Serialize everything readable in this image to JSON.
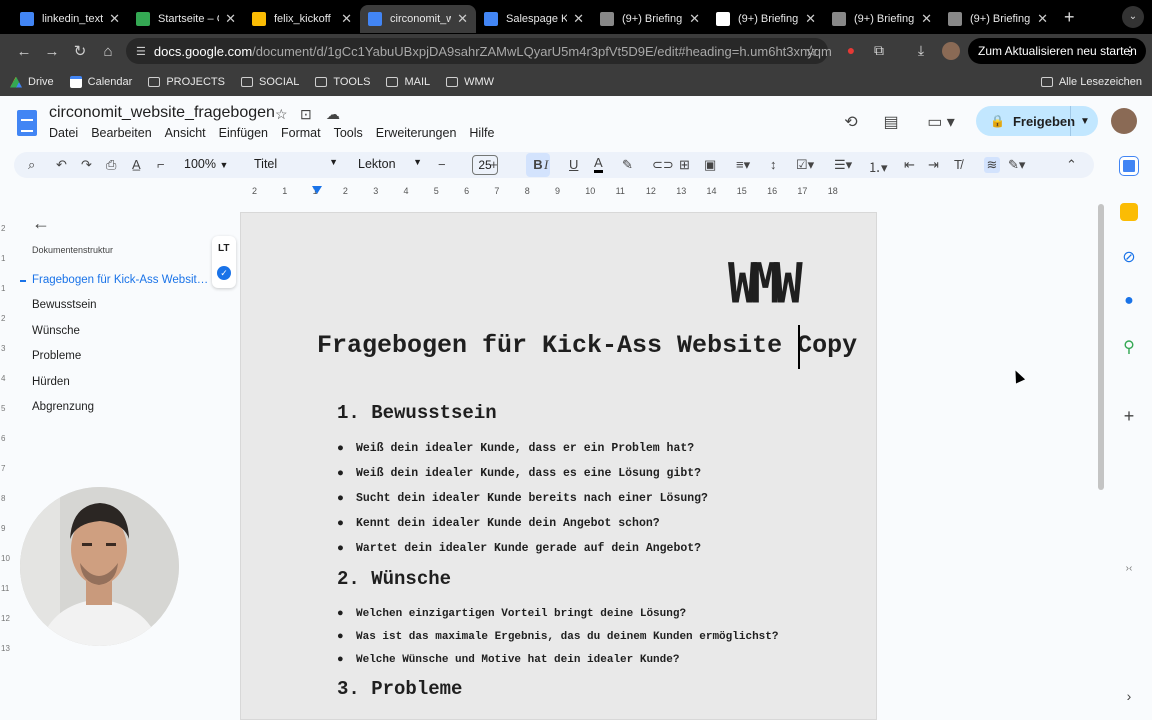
{
  "browser": {
    "tabs": [
      {
        "title": "linkedin_text",
        "color": "#4285f4"
      },
      {
        "title": "Startseite – G",
        "color": "#34a853"
      },
      {
        "title": "felix_kickoff",
        "color": "#fbbc04"
      },
      {
        "title": "circonomit_w",
        "color": "#4285f4"
      },
      {
        "title": "Salespage K",
        "color": "#4285f4"
      },
      {
        "title": "(9+) Briefing",
        "color": "#888888"
      },
      {
        "title": "(9+) Briefing",
        "color": "#ffffff"
      },
      {
        "title": "(9+) Briefing",
        "color": "#888888"
      },
      {
        "title": "(9+) Briefing",
        "color": "#888888"
      }
    ],
    "active_tab_index": 3,
    "url_host": "docs.google.com",
    "url_path": "/document/d/1gCc1YabuUBxpjDA9sahrZAMwLQyarU5m4r3pfVt5D9E/edit#heading=h.um6ht3xnyqm",
    "update_label": "Zum Aktualisieren neu starten",
    "bookmarks": [
      "Drive",
      "Calendar",
      "PROJECTS",
      "SOCIAL",
      "TOOLS",
      "MAIL",
      "WMW"
    ],
    "all_bookmarks": "Alle Lesezeichen"
  },
  "doc": {
    "title": "circonomit_website_fragebogen",
    "menu": [
      "Datei",
      "Bearbeiten",
      "Ansicht",
      "Einfügen",
      "Format",
      "Tools",
      "Erweiterungen",
      "Hilfe"
    ],
    "share_label": "Freigeben"
  },
  "toolbar": {
    "zoom": "100%",
    "style": "Titel",
    "font": "Lekton",
    "font_size": "25"
  },
  "ruler": [
    "2",
    "1",
    "1",
    "2",
    "3",
    "4",
    "5",
    "6",
    "7",
    "8",
    "9",
    "10",
    "11",
    "12",
    "13",
    "14",
    "15",
    "16",
    "17",
    "18"
  ],
  "outline": {
    "header": "Dokumentenstruktur",
    "items": [
      "Fragebogen für Kick-Ass Websit…",
      "Bewusstsein",
      "Wünsche",
      "Probleme",
      "Hürden",
      "Abgrenzung"
    ]
  },
  "content": {
    "logo": "WMW",
    "title": "Fragebogen für Kick-Ass Website Copy",
    "sections": [
      {
        "heading": "1.  Bewusstsein",
        "items": [
          "Weiß dein idealer Kunde, dass er ein Problem hat?",
          "Weiß dein idealer Kunde, dass es eine Lösung gibt?",
          "Sucht dein idealer Kunde bereits nach einer Lösung?",
          "Kennt dein idealer Kunde dein Angebot schon?",
          "Wartet dein idealer Kunde gerade auf dein Angebot?"
        ]
      },
      {
        "heading": "2.  Wünsche",
        "items": [
          "Welchen einzigartigen Vorteil bringt deine Lösung?",
          "Was ist das maximale Ergebnis, das du deinem Kunden ermöglichst?",
          "Welche Wünsche und Motive hat dein idealer Kunde?"
        ]
      },
      {
        "heading": "3.  Probleme",
        "items": []
      }
    ]
  }
}
